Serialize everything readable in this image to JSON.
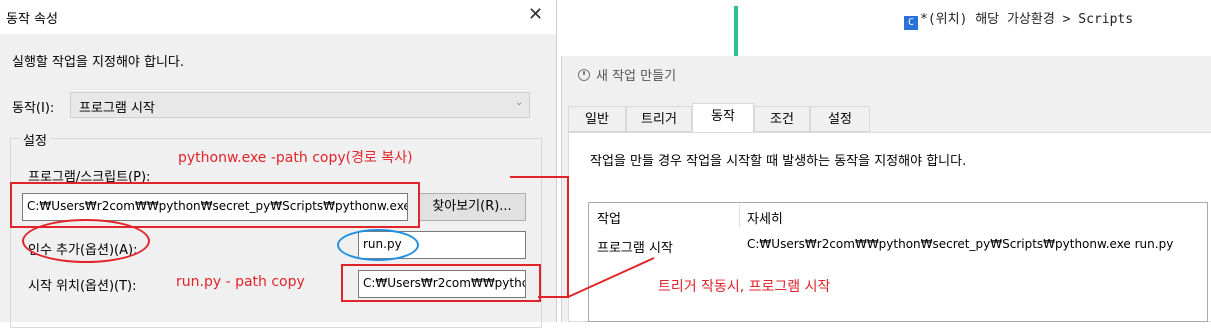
{
  "left_dialog": {
    "title": "동작 속성",
    "close_glyph": "✕",
    "instruction": "실행할 작업을 지정해야 합니다.",
    "action_label": "동작(I):",
    "action_value": "프로그램 시작",
    "settings_legend": "설정",
    "program_label": "프로그램/스크립트(P):",
    "program_value": "C:₩Users₩r2com₩₩python₩secret_py₩Scripts₩pythonw.exe",
    "browse_label": "찾아보기(R)...",
    "args_label": "인수 추가(옵션)(A):",
    "args_value": "run.py",
    "start_label": "시작 위치(옵션)(T):",
    "start_value": "C:₩Users₩r2com₩₩pythc"
  },
  "annotations": {
    "pythonw_note": "pythonw.exe -path copy(경로 복사)",
    "runpy_note": "run.py - path copy",
    "trigger_note": "트리거 작동시, 프로그램 시작",
    "color": "#e0242a",
    "circle_color": "#1f8fe0"
  },
  "ide": {
    "breadcrumb": "*(위치) 해당 가상환경 > Scripts",
    "icon": "C",
    "accent": "#2fc38c"
  },
  "new_task_window": {
    "title": "새 작업 만들기",
    "tabs": [
      "일반",
      "트리거",
      "동작",
      "조건",
      "설정"
    ],
    "active_tab": "동작",
    "description": "작업을 만들 경우 작업을 시작할 때 발생하는 동작을 지정해야 합니다.",
    "table": {
      "headers": [
        "작업",
        "자세히"
      ],
      "rows": [
        [
          "프로그램 시작",
          "C:₩Users₩r2com₩₩python₩secret_py₩Scripts₩pythonw.exe run.py"
        ]
      ]
    }
  }
}
